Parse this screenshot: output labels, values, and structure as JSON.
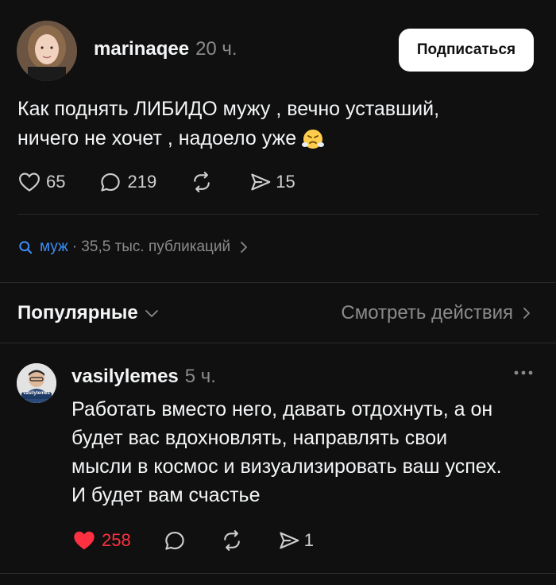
{
  "post": {
    "username": "marinaqee",
    "time": "20 ч.",
    "follow_label": "Подписаться",
    "text_line1": "Как поднять ЛИБИДО мужу , вечно уставший,",
    "text_line2": "ничего не хочет , надоело уже",
    "emoji": "face-with-steam-from-nose",
    "likes": "65",
    "comments": "219",
    "shares": "15"
  },
  "topic": {
    "name": "муж",
    "stats": "· 35,5 тыс. публикаций"
  },
  "sort": {
    "label": "Популярные",
    "view_actions": "Смотреть действия"
  },
  "comment": {
    "username": "vasilylemes",
    "time": "5 ч.",
    "avatar_caption": "vasilylemes",
    "text_lines": [
      "Работать вместо него, давать отдохнуть, а он",
      "будет вас вдохновлять, направлять свои",
      "мысли в космос и визуализировать ваш успех.",
      "И будет вам счастье"
    ],
    "likes": "258",
    "shares": "1"
  },
  "colors": {
    "background": "#101010",
    "accent_blue": "#3d8ef7",
    "like_red": "#ff3040",
    "muted": "#8a8a8a"
  }
}
